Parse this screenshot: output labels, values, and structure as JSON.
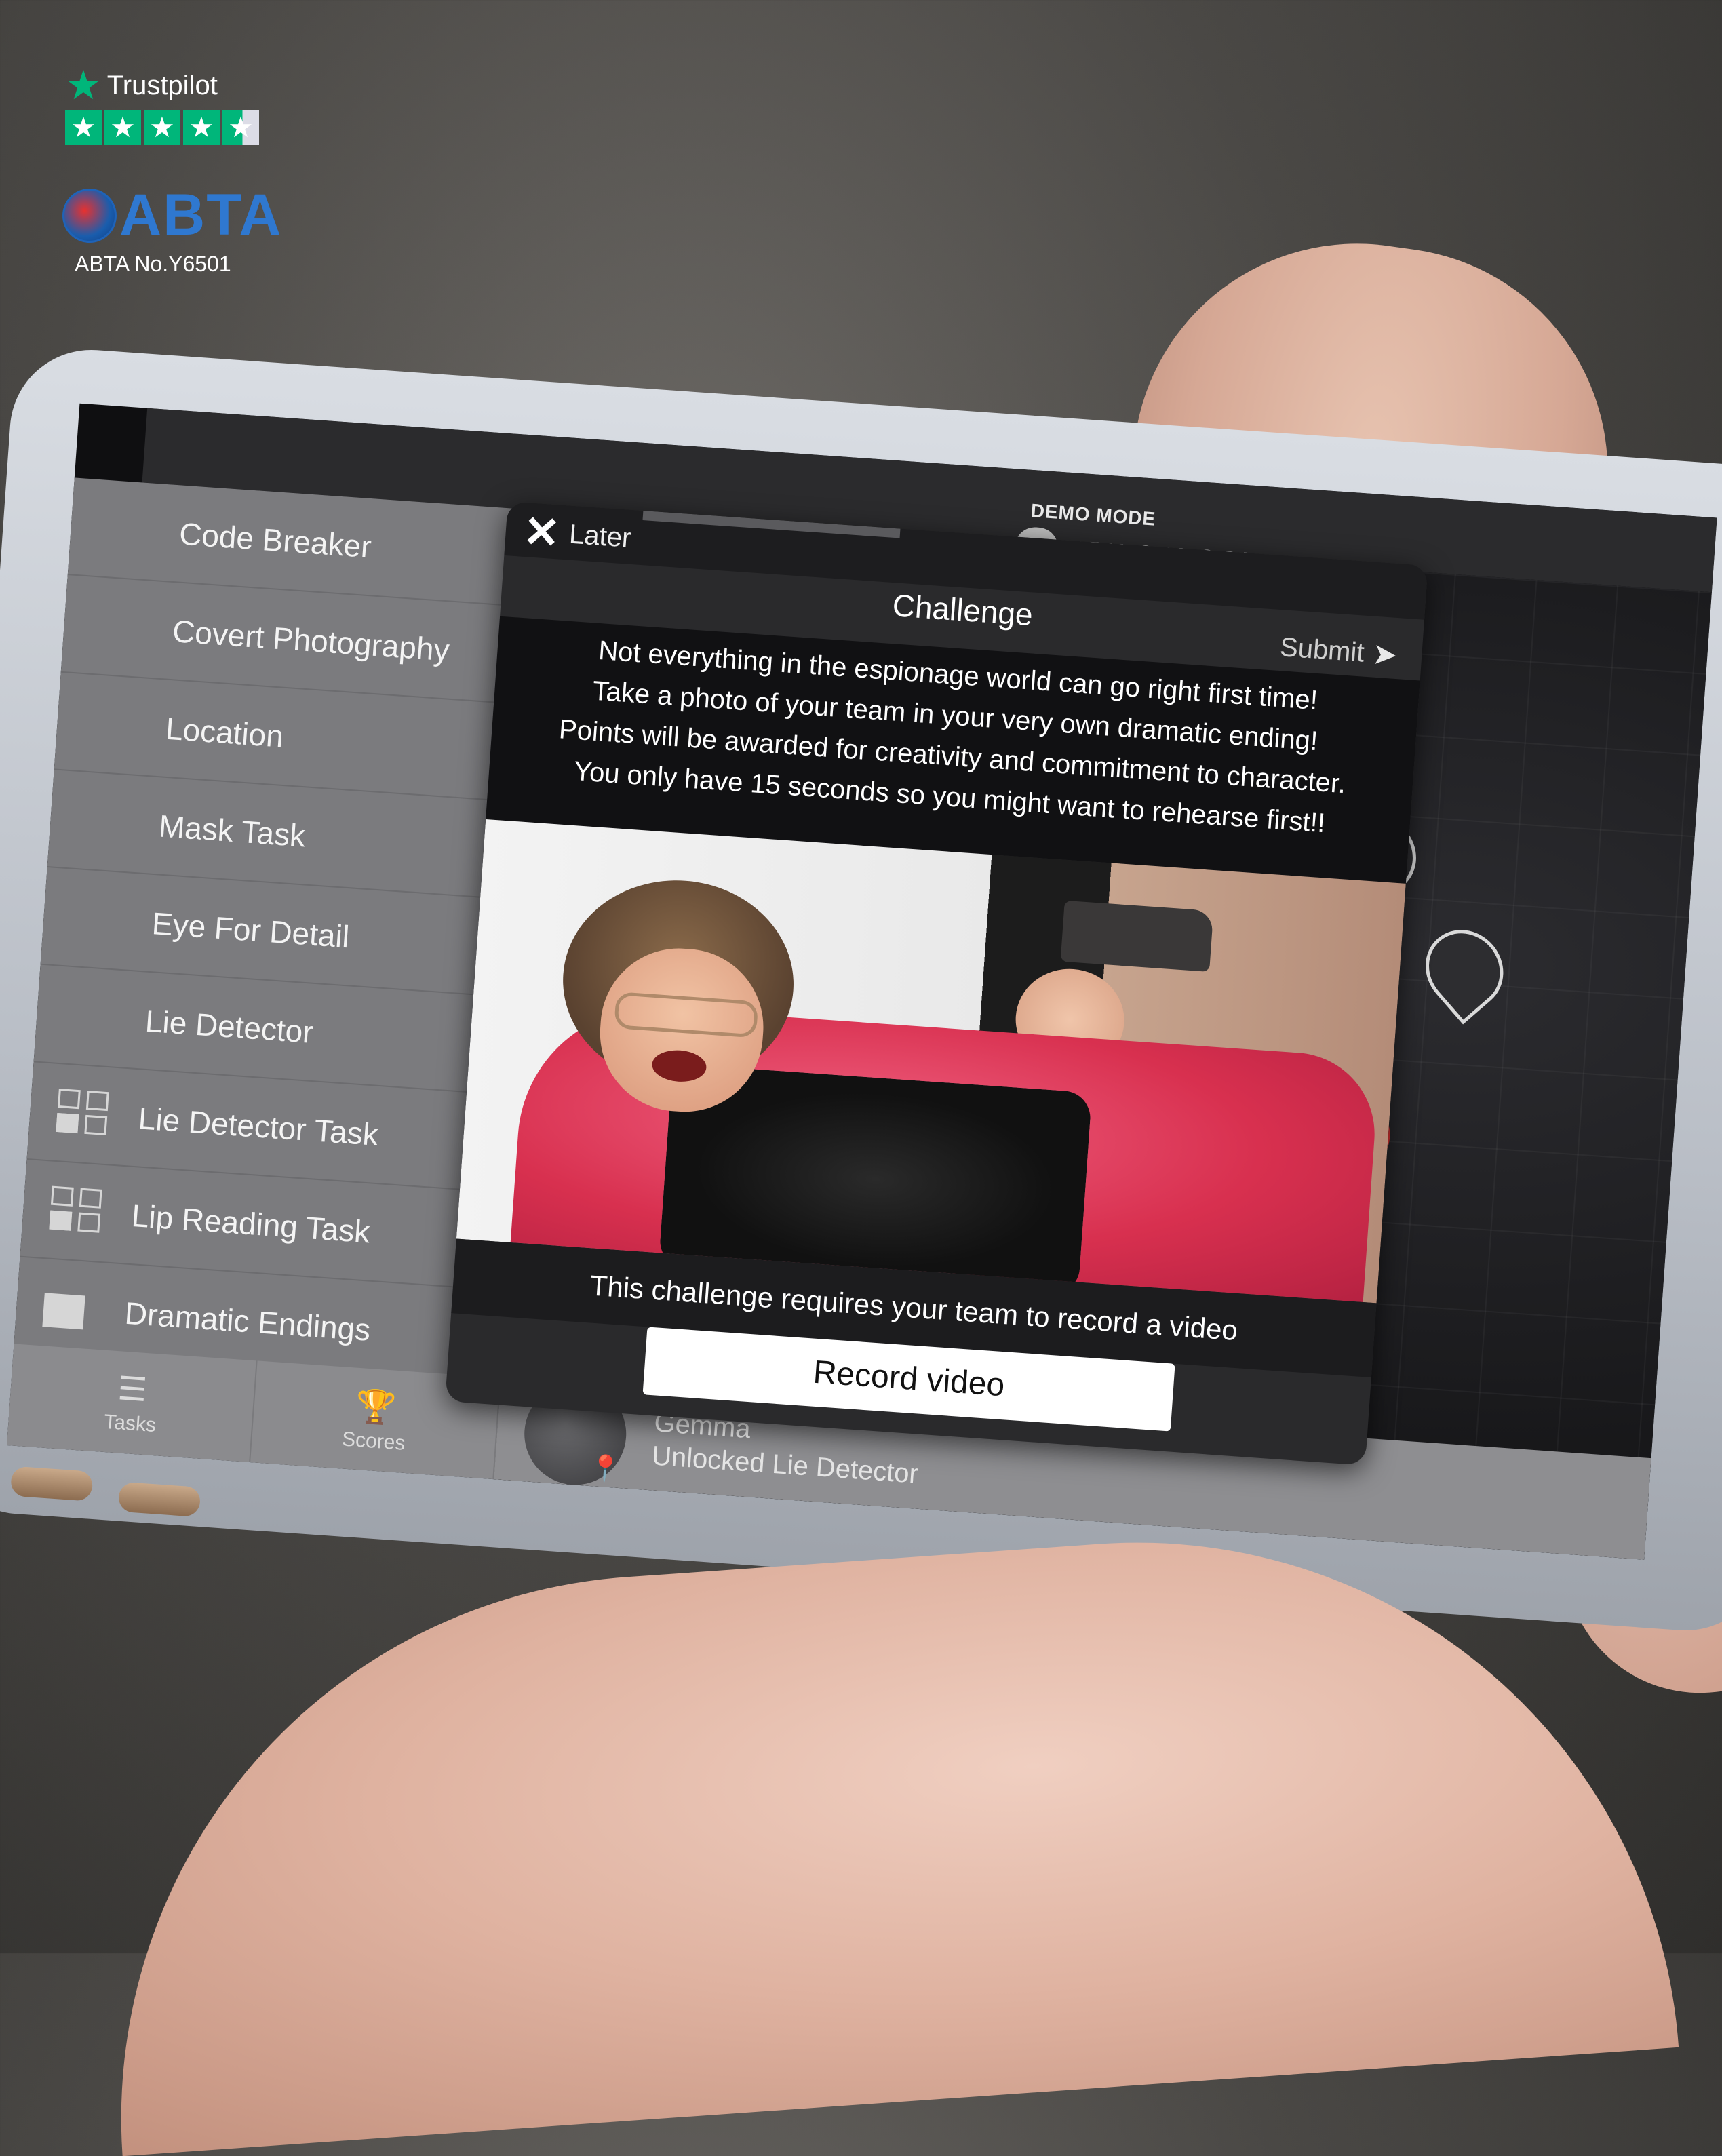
{
  "trustpilot": {
    "brand": "Trustpilot",
    "stars": [
      "★",
      "★",
      "★",
      "★",
      "★"
    ]
  },
  "abta": {
    "logo_text": "ABTA",
    "number": "ABTA No.Y6501"
  },
  "app": {
    "demo_mode": "DEMO MODE",
    "brand_text": "SPY SCHOOL"
  },
  "sidebar": {
    "items": [
      {
        "label": "Code Breaker"
      },
      {
        "label": "Covert Photography"
      },
      {
        "label": "Location"
      },
      {
        "label": "Mask Task"
      },
      {
        "label": "Eye For Detail"
      },
      {
        "label": "Lie Detector"
      },
      {
        "label": "Lie Detector Task",
        "icon": "tiles-icon"
      },
      {
        "label": "Lip Reading Task",
        "icon": "tiles-icon"
      },
      {
        "label": "Dramatic Endings",
        "icon": "clapperboard-icon"
      }
    ],
    "tabs": [
      {
        "label": "Tasks",
        "icon": "list-icon"
      },
      {
        "label": "Scores",
        "icon": "trophy-icon"
      }
    ]
  },
  "modal": {
    "later_label": "Later",
    "title": "Challenge",
    "submit_label": "Submit",
    "description": [
      "Not everything in the espionage world can go right first time!",
      "Take a photo of your team in your very own dramatic ending!",
      "Points will be awarded for creativity and commitment to character.",
      "You only have 15 seconds so you might want to rehearse first!!"
    ],
    "requires_text": "This challenge requires your team to record a video",
    "record_label": "Record video"
  },
  "feed": {
    "name": "Gemma",
    "status": "Unlocked Lie Detector"
  },
  "colors": {
    "trustpilot_green": "#00b67a",
    "abta_blue": "#2f78d0",
    "sidebar_bg": "#7b7b7e",
    "modal_bg": "#2a2a2c",
    "map_pin_alert": "#d4312f"
  }
}
